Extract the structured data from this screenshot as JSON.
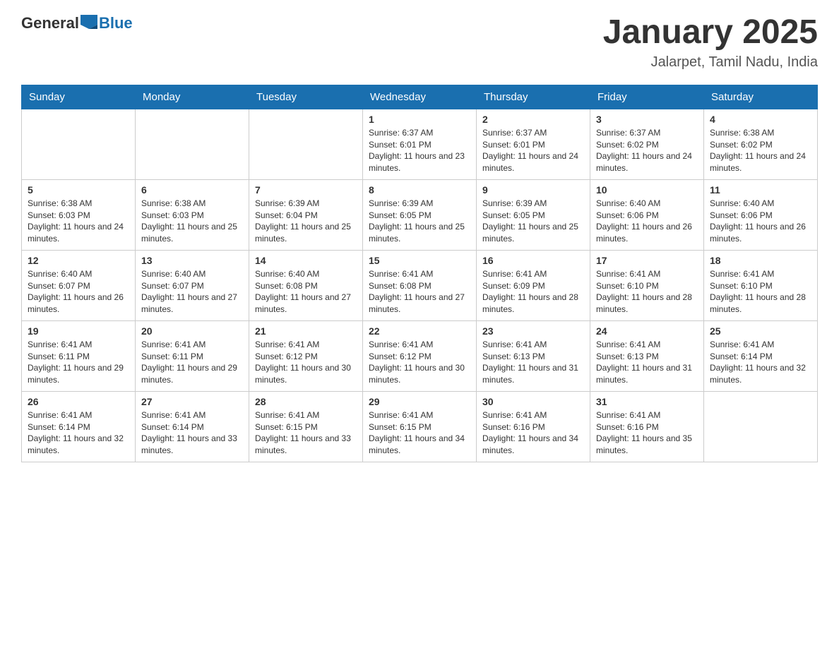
{
  "header": {
    "logo": {
      "general": "General",
      "blue": "Blue"
    },
    "title": "January 2025",
    "location": "Jalarpet, Tamil Nadu, India"
  },
  "days_of_week": [
    "Sunday",
    "Monday",
    "Tuesday",
    "Wednesday",
    "Thursday",
    "Friday",
    "Saturday"
  ],
  "weeks": [
    [
      {
        "day": null
      },
      {
        "day": null
      },
      {
        "day": null
      },
      {
        "day": "1",
        "sunrise": "6:37 AM",
        "sunset": "6:01 PM",
        "daylight": "11 hours and 23 minutes."
      },
      {
        "day": "2",
        "sunrise": "6:37 AM",
        "sunset": "6:01 PM",
        "daylight": "11 hours and 24 minutes."
      },
      {
        "day": "3",
        "sunrise": "6:37 AM",
        "sunset": "6:02 PM",
        "daylight": "11 hours and 24 minutes."
      },
      {
        "day": "4",
        "sunrise": "6:38 AM",
        "sunset": "6:02 PM",
        "daylight": "11 hours and 24 minutes."
      }
    ],
    [
      {
        "day": "5",
        "sunrise": "6:38 AM",
        "sunset": "6:03 PM",
        "daylight": "11 hours and 24 minutes."
      },
      {
        "day": "6",
        "sunrise": "6:38 AM",
        "sunset": "6:03 PM",
        "daylight": "11 hours and 25 minutes."
      },
      {
        "day": "7",
        "sunrise": "6:39 AM",
        "sunset": "6:04 PM",
        "daylight": "11 hours and 25 minutes."
      },
      {
        "day": "8",
        "sunrise": "6:39 AM",
        "sunset": "6:05 PM",
        "daylight": "11 hours and 25 minutes."
      },
      {
        "day": "9",
        "sunrise": "6:39 AM",
        "sunset": "6:05 PM",
        "daylight": "11 hours and 25 minutes."
      },
      {
        "day": "10",
        "sunrise": "6:40 AM",
        "sunset": "6:06 PM",
        "daylight": "11 hours and 26 minutes."
      },
      {
        "day": "11",
        "sunrise": "6:40 AM",
        "sunset": "6:06 PM",
        "daylight": "11 hours and 26 minutes."
      }
    ],
    [
      {
        "day": "12",
        "sunrise": "6:40 AM",
        "sunset": "6:07 PM",
        "daylight": "11 hours and 26 minutes."
      },
      {
        "day": "13",
        "sunrise": "6:40 AM",
        "sunset": "6:07 PM",
        "daylight": "11 hours and 27 minutes."
      },
      {
        "day": "14",
        "sunrise": "6:40 AM",
        "sunset": "6:08 PM",
        "daylight": "11 hours and 27 minutes."
      },
      {
        "day": "15",
        "sunrise": "6:41 AM",
        "sunset": "6:08 PM",
        "daylight": "11 hours and 27 minutes."
      },
      {
        "day": "16",
        "sunrise": "6:41 AM",
        "sunset": "6:09 PM",
        "daylight": "11 hours and 28 minutes."
      },
      {
        "day": "17",
        "sunrise": "6:41 AM",
        "sunset": "6:10 PM",
        "daylight": "11 hours and 28 minutes."
      },
      {
        "day": "18",
        "sunrise": "6:41 AM",
        "sunset": "6:10 PM",
        "daylight": "11 hours and 28 minutes."
      }
    ],
    [
      {
        "day": "19",
        "sunrise": "6:41 AM",
        "sunset": "6:11 PM",
        "daylight": "11 hours and 29 minutes."
      },
      {
        "day": "20",
        "sunrise": "6:41 AM",
        "sunset": "6:11 PM",
        "daylight": "11 hours and 29 minutes."
      },
      {
        "day": "21",
        "sunrise": "6:41 AM",
        "sunset": "6:12 PM",
        "daylight": "11 hours and 30 minutes."
      },
      {
        "day": "22",
        "sunrise": "6:41 AM",
        "sunset": "6:12 PM",
        "daylight": "11 hours and 30 minutes."
      },
      {
        "day": "23",
        "sunrise": "6:41 AM",
        "sunset": "6:13 PM",
        "daylight": "11 hours and 31 minutes."
      },
      {
        "day": "24",
        "sunrise": "6:41 AM",
        "sunset": "6:13 PM",
        "daylight": "11 hours and 31 minutes."
      },
      {
        "day": "25",
        "sunrise": "6:41 AM",
        "sunset": "6:14 PM",
        "daylight": "11 hours and 32 minutes."
      }
    ],
    [
      {
        "day": "26",
        "sunrise": "6:41 AM",
        "sunset": "6:14 PM",
        "daylight": "11 hours and 32 minutes."
      },
      {
        "day": "27",
        "sunrise": "6:41 AM",
        "sunset": "6:14 PM",
        "daylight": "11 hours and 33 minutes."
      },
      {
        "day": "28",
        "sunrise": "6:41 AM",
        "sunset": "6:15 PM",
        "daylight": "11 hours and 33 minutes."
      },
      {
        "day": "29",
        "sunrise": "6:41 AM",
        "sunset": "6:15 PM",
        "daylight": "11 hours and 34 minutes."
      },
      {
        "day": "30",
        "sunrise": "6:41 AM",
        "sunset": "6:16 PM",
        "daylight": "11 hours and 34 minutes."
      },
      {
        "day": "31",
        "sunrise": "6:41 AM",
        "sunset": "6:16 PM",
        "daylight": "11 hours and 35 minutes."
      },
      {
        "day": null
      }
    ]
  ],
  "labels": {
    "sunrise_prefix": "Sunrise: ",
    "sunset_prefix": "Sunset: ",
    "daylight_prefix": "Daylight: "
  }
}
